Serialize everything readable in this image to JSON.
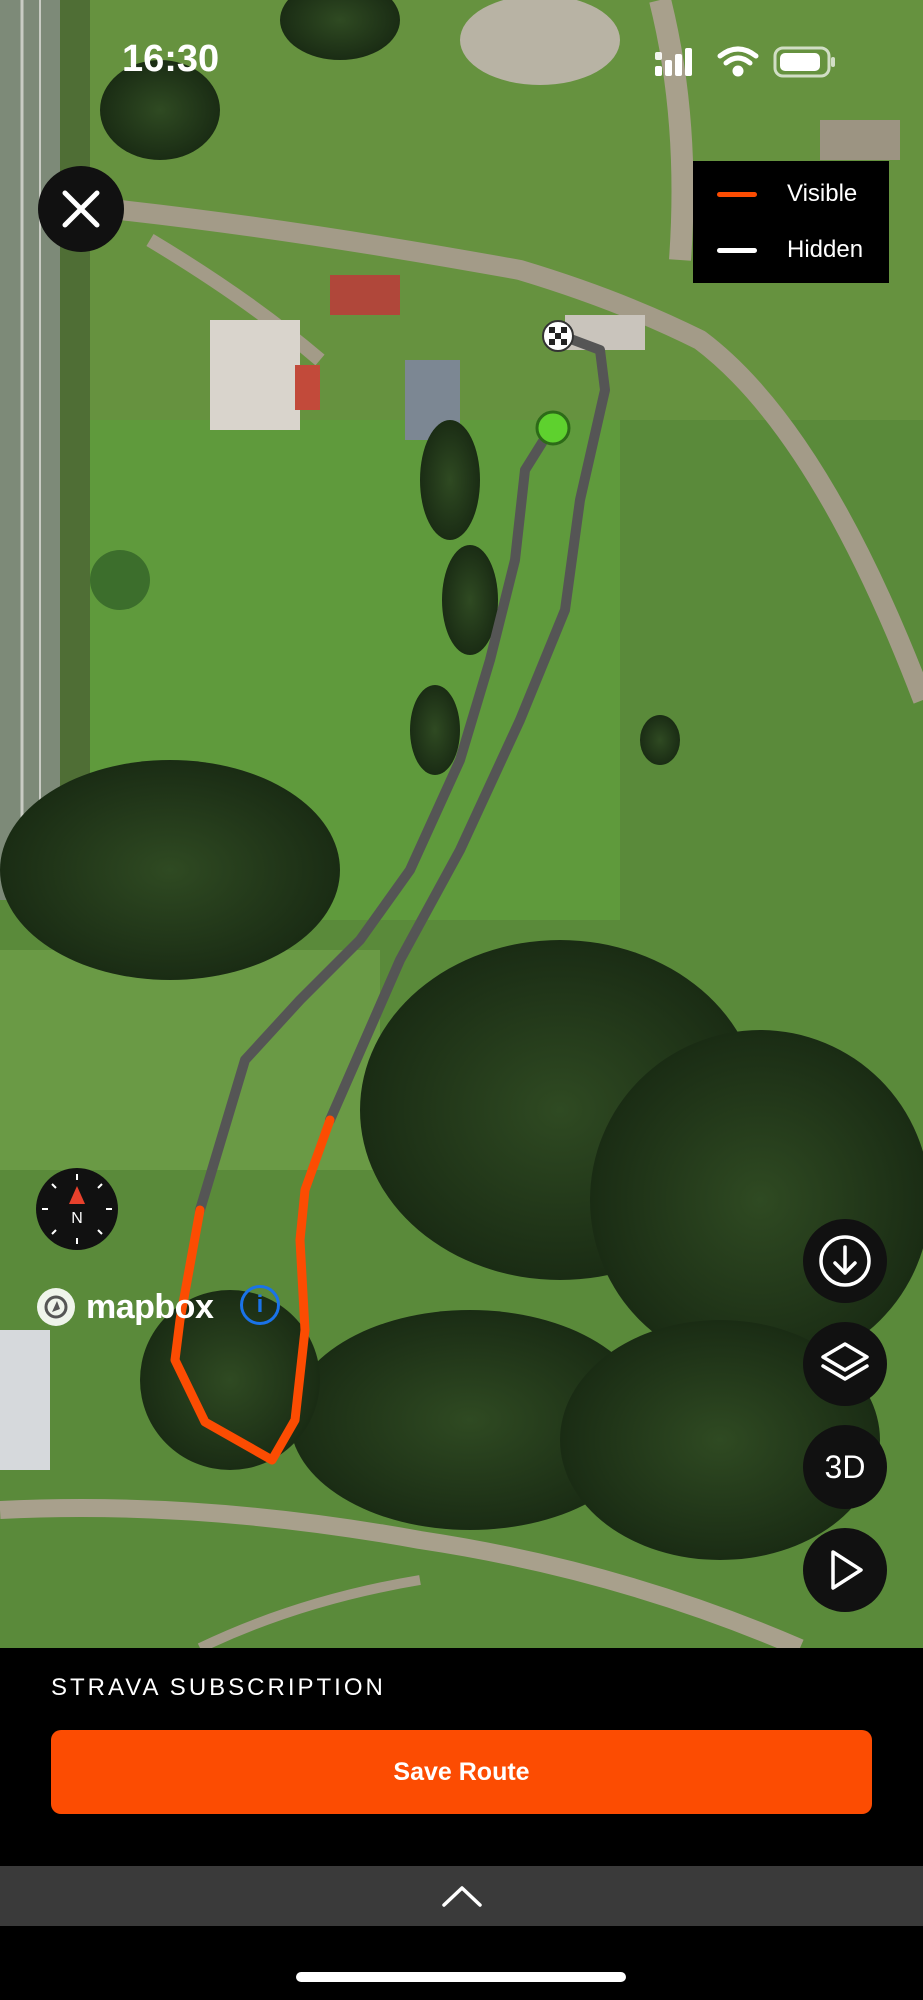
{
  "status_bar": {
    "time": "16:30"
  },
  "legend": {
    "items": [
      {
        "label": "Visible",
        "color": "#fc4c02"
      },
      {
        "label": "Hidden",
        "color": "#ffffff"
      }
    ]
  },
  "map": {
    "attribution": "mapbox",
    "compass_label": "N",
    "info_label": "i",
    "route_visible_color": "#fc4c02",
    "route_hidden_color": "#555555"
  },
  "controls": {
    "download_icon": "download-icon",
    "layers_icon": "layers-icon",
    "three_d_label": "3D",
    "play_icon": "play-icon"
  },
  "panel": {
    "title": "STRAVA SUBSCRIPTION",
    "save_label": "Save Route"
  }
}
